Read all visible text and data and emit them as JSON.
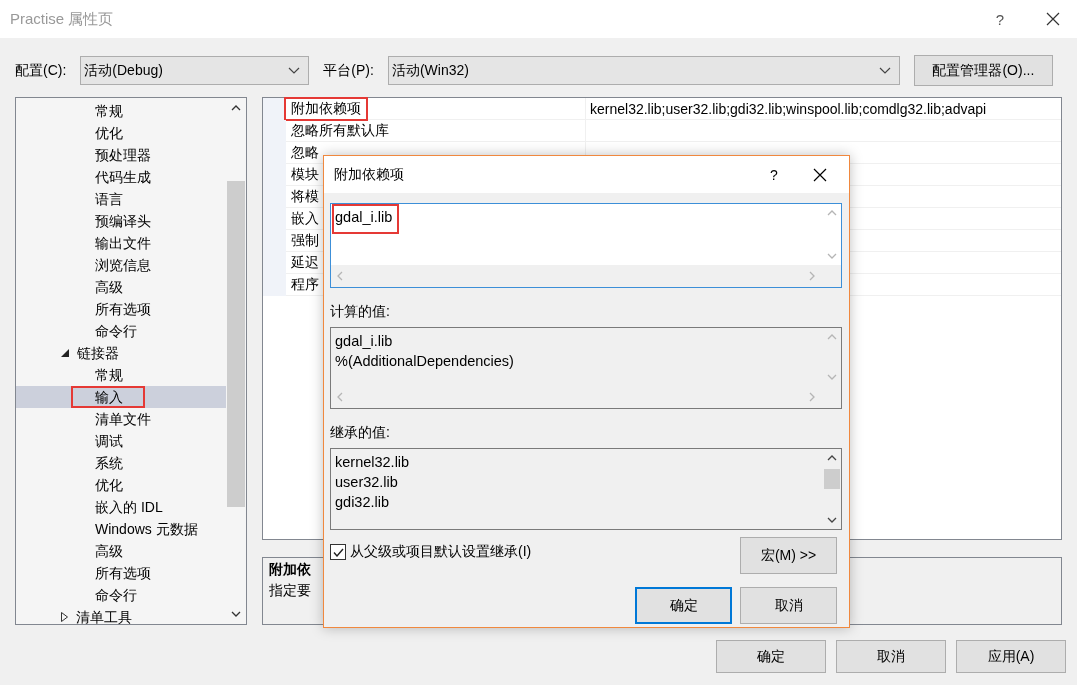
{
  "window": {
    "title": "Practise 属性页",
    "help": "?"
  },
  "config": {
    "label": "配置(C):",
    "value": "活动(Debug)"
  },
  "platform": {
    "label": "平台(P):",
    "value": "活动(Win32)"
  },
  "config_manager_button": "配置管理器(O)...",
  "tree": {
    "items": [
      {
        "children": [
          {
            "label": "常规",
            "selected": false,
            "marked": false
          },
          {
            "label": "优化",
            "selected": false,
            "marked": false
          },
          {
            "label": "预处理器",
            "selected": false,
            "marked": false
          },
          {
            "label": "代码生成",
            "selected": false,
            "marked": false
          },
          {
            "label": "语言",
            "selected": false,
            "marked": false
          },
          {
            "label": "预编译头",
            "selected": false,
            "marked": false
          },
          {
            "label": "输出文件",
            "selected": false,
            "marked": false
          },
          {
            "label": "浏览信息",
            "selected": false,
            "marked": false
          },
          {
            "label": "高级",
            "selected": false,
            "marked": false
          },
          {
            "label": "所有选项",
            "selected": false,
            "marked": false
          },
          {
            "label": "命令行",
            "selected": false,
            "marked": false
          }
        ]
      },
      {
        "label": "链接器",
        "expanded": true,
        "selected": false,
        "marked": false,
        "children": [
          {
            "label": "常规",
            "selected": false,
            "marked": false
          },
          {
            "label": "输入",
            "selected": true,
            "marked": true
          },
          {
            "label": "清单文件",
            "selected": false,
            "marked": false
          },
          {
            "label": "调试",
            "selected": false,
            "marked": false
          },
          {
            "label": "系统",
            "selected": false,
            "marked": false
          },
          {
            "label": "优化",
            "selected": false,
            "marked": false
          },
          {
            "label": "嵌入的 IDL",
            "selected": false,
            "marked": false
          },
          {
            "label": "Windows 元数据",
            "selected": false,
            "marked": false
          },
          {
            "label": "高级",
            "selected": false,
            "marked": false
          },
          {
            "label": "所有选项",
            "selected": false,
            "marked": false
          },
          {
            "label": "命令行",
            "selected": false,
            "marked": false
          }
        ]
      },
      {
        "label": "清单工具",
        "expanded": false,
        "selected": false,
        "marked": false
      }
    ]
  },
  "properties": [
    {
      "name": "附加依赖项",
      "value": "kernel32.lib;user32.lib;gdi32.lib;winspool.lib;comdlg32.lib;advapi",
      "marked": true
    },
    {
      "name": "忽略所有默认库",
      "marked": false
    },
    {
      "name": "忽略",
      "marked": false
    },
    {
      "name": "模块",
      "marked": false
    },
    {
      "name": "将模",
      "marked": false
    },
    {
      "name": "嵌入",
      "marked": false
    },
    {
      "name": "强制",
      "marked": false
    },
    {
      "name": "延迟",
      "marked": false
    },
    {
      "name": "程序",
      "marked": false
    }
  ],
  "description": {
    "title": "附加依",
    "text": "指定要"
  },
  "buttons": [
    "确定",
    "取消",
    "应用(A)"
  ],
  "dialog": {
    "title": "附加依赖项",
    "help": "?",
    "edit_lines": [
      {
        "text": "gdal_i.lib",
        "marked": true
      }
    ],
    "computed_label": "计算的值:",
    "computed_lines": [
      "gdal_i.lib",
      "%(AdditionalDependencies)"
    ],
    "inherited_label": "继承的值:",
    "inherited_lines": [
      "kernel32.lib",
      "user32.lib",
      "gdi32.lib"
    ],
    "inherit_checkbox": {
      "label": "从父级或项目默认设置继承(I)",
      "checked": true
    },
    "macro_button": "宏(M) >>",
    "buttons": [
      {
        "label": "确定",
        "default": true
      },
      {
        "label": "取消",
        "default": false
      }
    ]
  }
}
